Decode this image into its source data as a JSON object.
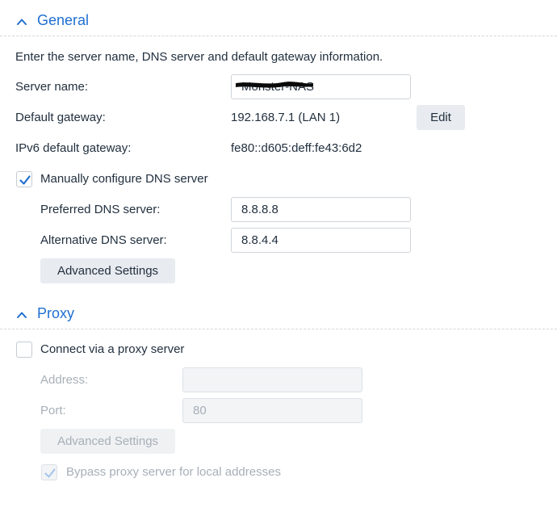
{
  "general": {
    "section_title": "General",
    "description": "Enter the server name, DNS server and default gateway information.",
    "server_name_label": "Server name:",
    "server_name_value": "Monster-NAS",
    "default_gateway_label": "Default gateway:",
    "default_gateway_value": "192.168.7.1 (LAN 1)",
    "edit_button": "Edit",
    "ipv6_gateway_label": "IPv6 default gateway:",
    "ipv6_gateway_value": "fe80::d605:deff:fe43:6d2",
    "manual_dns_label": "Manually configure DNS server",
    "manual_dns_checked": true,
    "preferred_dns_label": "Preferred DNS server:",
    "preferred_dns_value": "8.8.8.8",
    "alternative_dns_label": "Alternative DNS server:",
    "alternative_dns_value": "8.8.4.4",
    "advanced_settings_button": "Advanced Settings"
  },
  "proxy": {
    "section_title": "Proxy",
    "connect_label": "Connect via a proxy server",
    "connect_checked": false,
    "address_label": "Address:",
    "address_value": "",
    "port_label": "Port:",
    "port_value": "80",
    "advanced_settings_button": "Advanced Settings",
    "bypass_label": "Bypass proxy server for local addresses",
    "bypass_checked": true
  },
  "colors": {
    "accent": "#1f6fd1",
    "text": "#22303f",
    "disabled_text": "#a7afb8",
    "button_bg": "#e8ebef"
  },
  "icons": {
    "section_collapse": "chevron-up-icon",
    "check": "checkmark-icon"
  }
}
